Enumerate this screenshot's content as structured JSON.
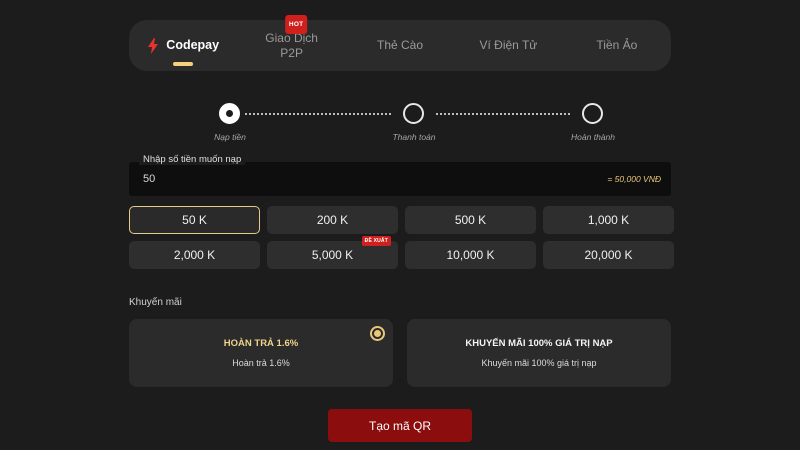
{
  "tabs": [
    {
      "label": "Codepay",
      "active": true,
      "icon": "lightning-icon"
    },
    {
      "label": "Giao Dịch",
      "label2": "P2P",
      "badge": "HOT"
    },
    {
      "label": "Thẻ Cào"
    },
    {
      "label": "Ví Điện Tử"
    },
    {
      "label": "Tiền Ảo"
    }
  ],
  "stepper": {
    "steps": [
      {
        "label": "Nạp tiền",
        "state": "current"
      },
      {
        "label": "Thanh toán",
        "state": "pending"
      },
      {
        "label": "Hoàn thành",
        "state": "pending"
      }
    ]
  },
  "amount": {
    "label": "Nhập số tiền muốn nạp",
    "value": "50",
    "conversion": "= 50,000 VNĐ"
  },
  "presets": [
    {
      "label": "50 K",
      "selected": true
    },
    {
      "label": "200 K"
    },
    {
      "label": "500 K"
    },
    {
      "label": "1,000 K"
    },
    {
      "label": "2,000 K"
    },
    {
      "label": "5,000 K",
      "badge": "ĐỀ XUẤT"
    },
    {
      "label": "10,000 K"
    },
    {
      "label": "20,000 K"
    }
  ],
  "promotions": {
    "title": "Khuyến mãi",
    "items": [
      {
        "name": "HOÀN TRẢ 1.6%",
        "desc": "Hoàn trả 1.6%",
        "selected": true
      },
      {
        "name": "KHUYẾN MÃI 100% GIÁ TRỊ NẠP",
        "desc": "Khuyến mãi 100% giá trị nạp",
        "selected": false
      }
    ]
  },
  "submit_label": "Tạo mã QR",
  "colors": {
    "background": "#1c1c1c",
    "panel": "#2b2b2b",
    "accent_gold": "#e9c77a",
    "brand_red": "#d0201d",
    "button_red": "#8b0d0d"
  }
}
